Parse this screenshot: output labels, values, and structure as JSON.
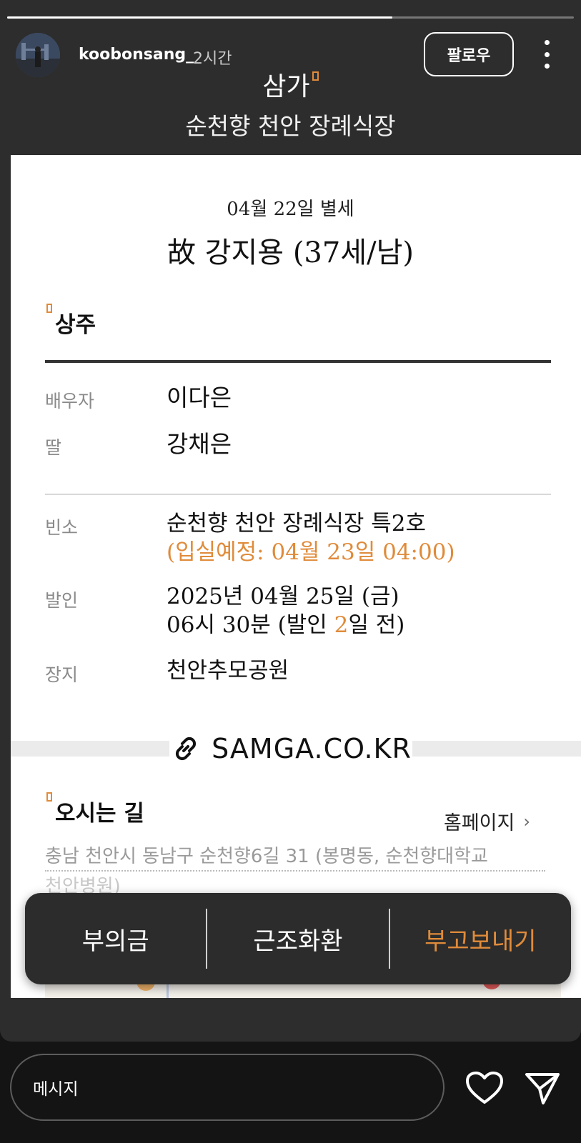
{
  "story": {
    "progress": 0.68,
    "username": "koobonsang_",
    "time": "2시간",
    "follow_label": "팔로우",
    "brand": "삼가",
    "subtitle": "순천향 천안 장례식장"
  },
  "card": {
    "date": "04월 22일 별세",
    "name": "故 강지용 (37세/남)",
    "chief_mourner_title": "상주",
    "spouse_label": "배우자",
    "spouse_value": "이다은",
    "daughter_label": "딸",
    "daughter_value": "강채은",
    "room_label": "빈소",
    "room_value": "순천향 천안 장례식장 특2호",
    "room_note": "(입실예정: 04월 23일 04:00)",
    "departure_label": "발인",
    "departure_line1": "2025년 04월 25일 (금)",
    "departure_line2_prefix": "06시 30분 (발인 ",
    "departure_days": "2",
    "departure_line2_suffix": "일 전)",
    "burial_label": "장지",
    "burial_value": "천안추모공원",
    "samga_link": "SAMGA.CO.KR",
    "directions_title": "오시는 길",
    "homepage_label": "홈페이지",
    "address_line1": "충남 천안시 동남구 순천향6길 31 (봉명동, 순천향대학교",
    "address_line2": "천안병원)"
  },
  "actions": {
    "condolence_money": "부의금",
    "flowers": "근조화환",
    "send_notice": "부고보내기"
  },
  "footer": {
    "message_placeholder": "메시지"
  },
  "colors": {
    "accent": "#e08b3a",
    "story_bg": "#2d2d2d"
  }
}
